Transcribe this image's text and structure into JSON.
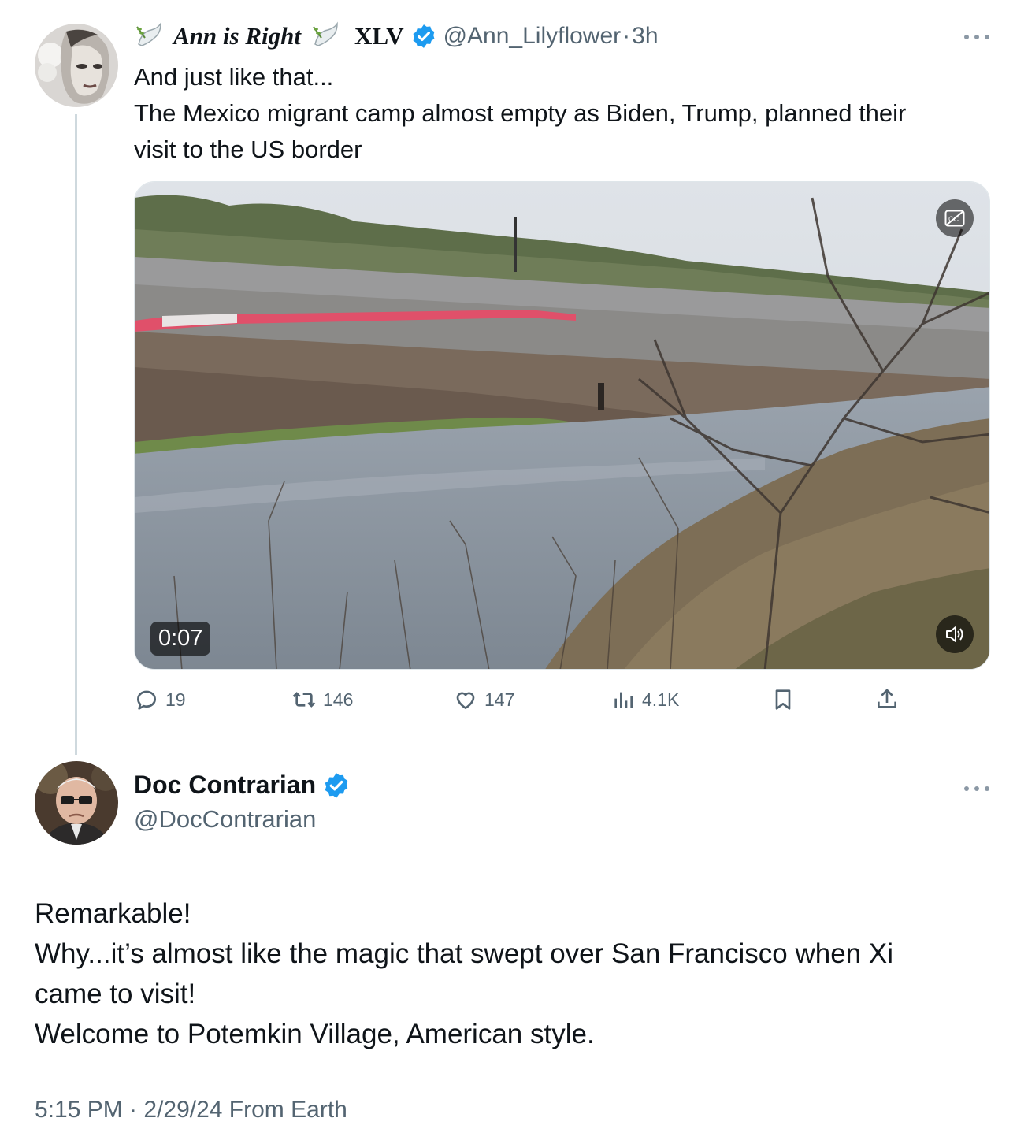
{
  "parent_tweet": {
    "display_name": "Ann is Right",
    "name_suffix": "XLV",
    "handle": "@Ann_Lilyflower",
    "separator": "·",
    "time": "3h",
    "text_lines": [
      "And just like that...",
      "The Mexico migrant camp almost empty as Biden, Trump, planned their",
      "visit to the US border"
    ],
    "video": {
      "duration": "0:07"
    },
    "stats": {
      "replies": "19",
      "reposts": "146",
      "likes": "147",
      "views": "4.1K"
    }
  },
  "reply_tweet": {
    "display_name": "Doc Contrarian",
    "handle": "@DocContrarian",
    "text_lines": [
      "Remarkable!",
      "Why...it’s almost like the magic that swept over San Francisco when Xi",
      "came to visit!",
      "Welcome to Potemkin Village, American style."
    ],
    "timestamp": "5:15 PM · 2/29/24 From Earth"
  },
  "icons": {
    "verified": "verified-badge-icon",
    "dove": "dove-emoji-icon",
    "more": "more-icon",
    "reply": "reply-icon",
    "repost": "repost-icon",
    "like": "like-icon",
    "views": "views-icon",
    "bookmark": "bookmark-icon",
    "share": "share-icon",
    "captions": "captions-icon",
    "volume": "volume-icon"
  },
  "colors": {
    "accent": "#1d9bf0",
    "secondary_text": "#536471",
    "thread_line": "#cfd9de"
  }
}
